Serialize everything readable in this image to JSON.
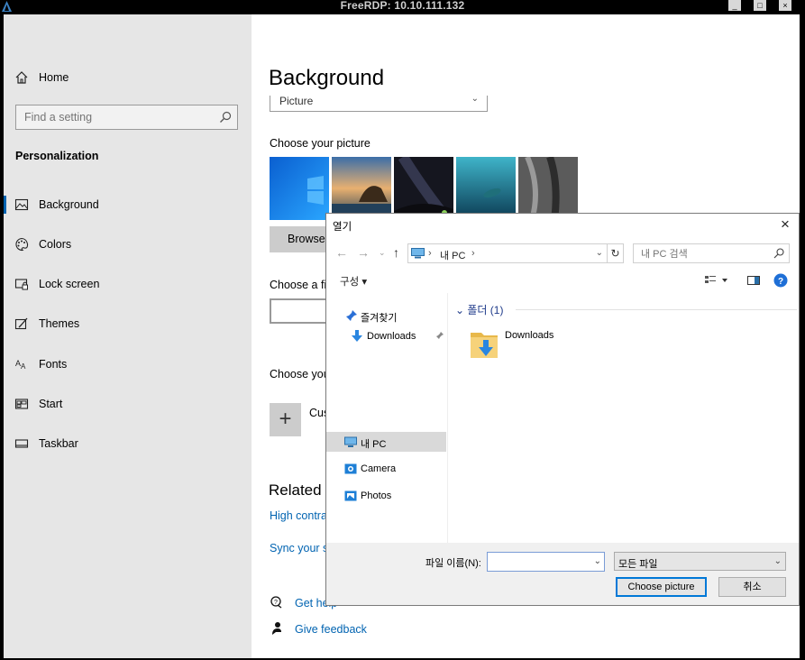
{
  "rdp": {
    "title": "FreeRDP: 10.10.111.132",
    "minimize": "_",
    "maximize": "□",
    "close": "×"
  },
  "sidebar": {
    "home": "Home",
    "search_placeholder": "Find a setting",
    "section": "Personalization",
    "items": [
      {
        "label": "Background",
        "icon": "image-icon",
        "selected": true
      },
      {
        "label": "Colors",
        "icon": "palette-icon"
      },
      {
        "label": "Lock screen",
        "icon": "lock-screen-icon"
      },
      {
        "label": "Themes",
        "icon": "themes-icon"
      },
      {
        "label": "Fonts",
        "icon": "fonts-icon"
      },
      {
        "label": "Start",
        "icon": "start-icon"
      },
      {
        "label": "Taskbar",
        "icon": "taskbar-icon"
      }
    ]
  },
  "main": {
    "title": "Background",
    "background_type": "Picture",
    "choose_picture": "Choose your picture",
    "browse": "Browse",
    "choose_fit": "Choose a fi",
    "choose_your": "Choose you",
    "custom": "Cus",
    "related": "Related",
    "high_contrast": "High contra",
    "sync": "Sync your s",
    "get_help": "Get help",
    "give_feedback": "Give feedback",
    "accent_color": "#0063b1"
  },
  "dialog": {
    "title": "열기",
    "close": "×",
    "address_pc": "내 PC",
    "address_sep": "›",
    "search_placeholder": "내 PC 검색",
    "organize": "구성 ▾",
    "tree": {
      "favorites": "즐겨찾기",
      "downloads": "Downloads",
      "this_pc": "내 PC",
      "camera": "Camera",
      "photos": "Photos"
    },
    "folders_header": "폴더 (1)",
    "folder_name": "Downloads",
    "filename_label": "파일 이름(N):",
    "filename_value": "",
    "filetype": "모든 파일",
    "choose_button": "Choose picture",
    "cancel_button": "취소"
  }
}
